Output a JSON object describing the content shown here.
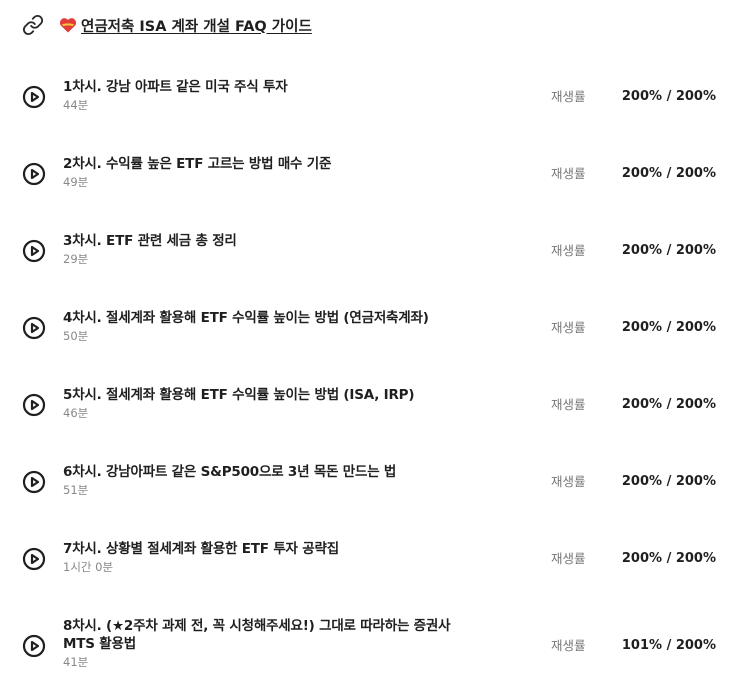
{
  "header": {
    "link_text": "연금저축 ISA 계좌 개설 FAQ 가이드",
    "link_icon": "link-icon",
    "heart_icon": "heart-icon",
    "heart_color": "#e23b3b"
  },
  "playback_label": "재생률",
  "lessons": [
    {
      "title": "1차시. 강남 아파트 같은 미국 주식 투자",
      "duration": "44분",
      "rate": "200% / 200%"
    },
    {
      "title": "2차시. 수익률 높은 ETF 고르는 방법 매수 기준",
      "duration": "49분",
      "rate": "200% / 200%"
    },
    {
      "title": "3차시. ETF 관련 세금 총 정리",
      "duration": "29분",
      "rate": "200% / 200%"
    },
    {
      "title": "4차시. 절세계좌 활용해 ETF 수익률 높이는 방법 (연금저축계좌)",
      "duration": "50분",
      "rate": "200% / 200%"
    },
    {
      "title": "5차시. 절세계좌 활용해 ETF 수익률 높이는 방법 (ISA, IRP)",
      "duration": "46분",
      "rate": "200% / 200%"
    },
    {
      "title": "6차시. 강남아파트 같은 S&P500으로 3년 목돈 만드는 법",
      "duration": "51분",
      "rate": "200% / 200%"
    },
    {
      "title": "7차시. 상황별 절세계좌 활용한 ETF 투자 공략집",
      "duration": "1시간 0분",
      "rate": "200% / 200%"
    },
    {
      "title": "8차시. (★2주차 과제 전, 꼭 시청해주세요!) 그대로 따라하는 증권사",
      "title_line2": "MTS 활용법",
      "duration": "41분",
      "rate": "101% / 200%"
    }
  ]
}
